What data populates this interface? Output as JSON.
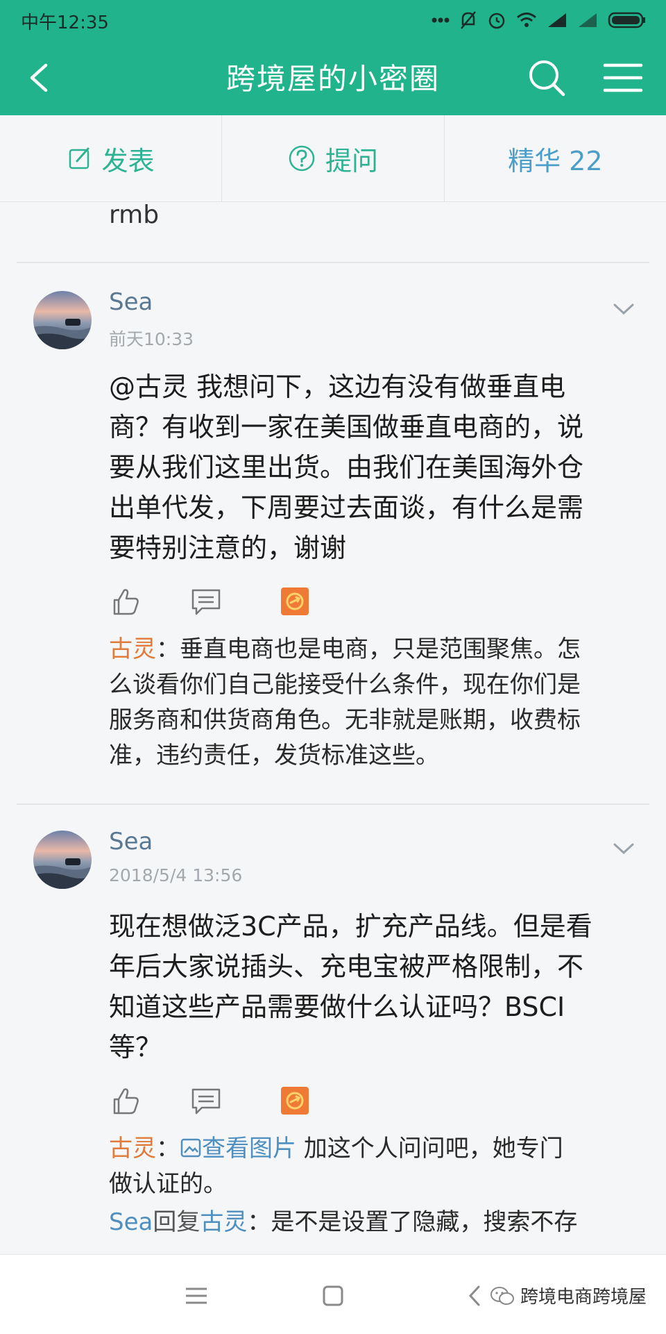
{
  "status_bar": {
    "time": "中午12:35"
  },
  "app_bar": {
    "title": "跨境屋的小密圈"
  },
  "tabs": [
    {
      "label": "发表"
    },
    {
      "label": "提问"
    },
    {
      "label": "精华 22"
    }
  ],
  "feed": {
    "previous_tail": "rmb",
    "posts": [
      {
        "author": "Sea",
        "time": "前天10:33",
        "text_lines": [
          "@古灵  我想问下，这边有没有做垂直电",
          "商？有收到一家在美国做垂直电商的，说",
          "要从我们这里出货。由我们在美国海外仓",
          "出单代发，下周要过去面谈，有什么是需",
          "要特别注意的，谢谢"
        ],
        "replies": [
          {
            "name": "古灵",
            "sep": "：",
            "lines": [
              "垂直电商也是电商，只是范围聚焦。怎",
              "么谈看你们自己能接受什么条件，现在你们是",
              "服务商和供货商角色。无非就是账期，收费标",
              "准，违约责任，发货标准这些。"
            ]
          }
        ]
      },
      {
        "author": "Sea",
        "time": "2018/5/4 13:56",
        "text_lines": [
          "现在想做泛3C产品，扩充产品线。但是看",
          "年后大家说插头、充电宝被严格限制，不",
          "知道这些产品需要做什么认证吗？BSCI",
          "等？"
        ],
        "replies": [
          {
            "name": "古灵",
            "sep": "：",
            "link": "查看图片",
            "line1": " 加这个人问问吧，她专门",
            "line2": "做认证的。"
          },
          {
            "name": "Sea",
            "mid": "回复",
            "name2": "古灵",
            "sep": "：",
            "text": "是不是设置了隐藏，搜索不存"
          }
        ]
      }
    ]
  },
  "watermark": {
    "text": "跨境电商跨境屋"
  },
  "colors": {
    "brand_green": "#21b38c",
    "reply_name_orange": "#e07b3c",
    "link_blue": "#4f8fbf"
  }
}
